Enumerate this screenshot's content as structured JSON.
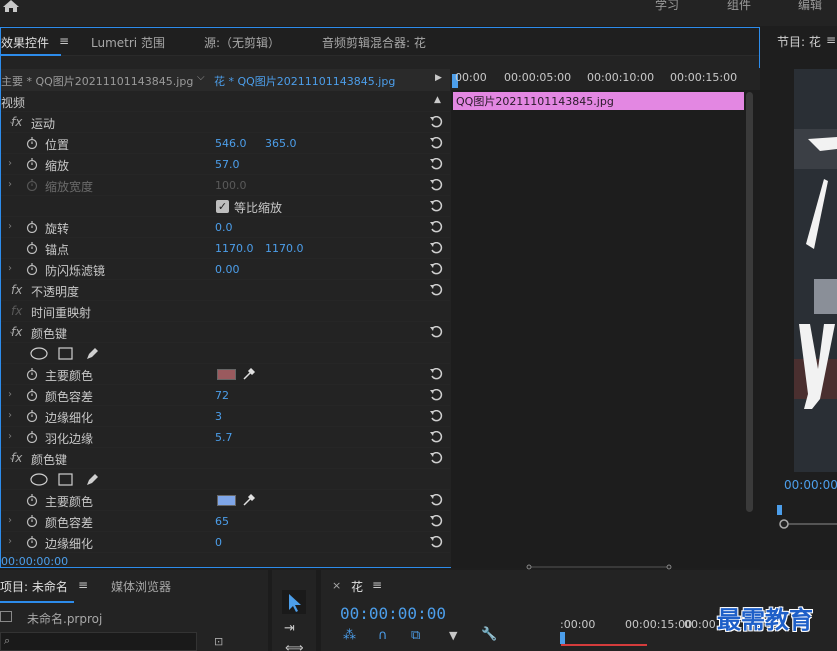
{
  "workspaces": [
    "学习",
    "组件",
    "编辑"
  ],
  "ec_tabs": [
    "效果控件",
    "Lumetri 范围",
    "源:（无剪辑）",
    "音频剪辑混合器: 花"
  ],
  "clip_master": "主要 * QQ图片20211101143845.jpg",
  "clip_sequence": "花 * QQ图片20211101143845.jpg",
  "section_video": "视频",
  "effects": {
    "motion": "运动",
    "position": {
      "label": "位置",
      "x": "546.0",
      "y": "365.0"
    },
    "scale": {
      "label": "缩放",
      "value": "57.0"
    },
    "scale_width": {
      "label": "缩放宽度",
      "value": "100.0"
    },
    "uniform_scale": "等比缩放",
    "rotation": {
      "label": "旋转",
      "value": "0.0"
    },
    "anchor": {
      "label": "锚点",
      "x": "1170.0",
      "y": "1170.0"
    },
    "anti_flicker": {
      "label": "防闪烁滤镜",
      "value": "0.00"
    },
    "opacity": "不透明度",
    "time_remap": "时间重映射",
    "color_key_1": {
      "name": "颜色键",
      "key_color_label": "主要颜色",
      "key_color": "#9a5a5e",
      "tolerance": {
        "label": "颜色容差",
        "value": "72"
      },
      "edge_thin": {
        "label": "边缘细化",
        "value": "3"
      },
      "feather": {
        "label": "羽化边缘",
        "value": "5.7"
      }
    },
    "color_key_2": {
      "name": "颜色键",
      "key_color_label": "主要颜色",
      "key_color": "#7fa6e8",
      "tolerance": {
        "label": "颜色容差",
        "value": "65"
      },
      "edge_thin": {
        "label": "边缘细化",
        "value": "0"
      }
    }
  },
  "timeline": {
    "ticks": [
      "00:00",
      "00:00:05:00",
      "00:00:10:00",
      "00:00:15:00"
    ],
    "clip_name": "QQ图片20211101143845.jpg"
  },
  "panel_timecode": "00:00:00:00",
  "program": {
    "title": "节目: 花",
    "timecode": "00:00:00"
  },
  "project": {
    "tab": "项目: 未命名",
    "tab2": "媒体浏览器",
    "file": "未命名.prproj"
  },
  "sequence": {
    "name": "花",
    "timecode": "00:00:00:00",
    "ticks": [
      ":00:00",
      "00:00:15:00",
      "00:00"
    ]
  },
  "watermark": "最需教育"
}
